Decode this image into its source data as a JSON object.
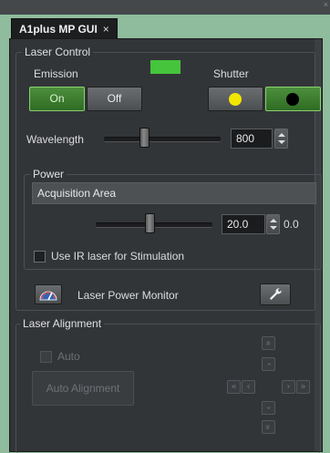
{
  "window": {
    "tab_title": "A1plus MP GUI",
    "tab_close": "×",
    "corner_close": "×"
  },
  "laser_control": {
    "title": "Laser Control",
    "emission_label": "Emission",
    "on_label": "On",
    "off_label": "Off",
    "emission_state": "on",
    "indicator_color": "#45c53c",
    "shutter_label": "Shutter",
    "shutter_open_color": "#f2e600",
    "shutter_closed_color": "#000000",
    "wavelength_label": "Wavelength",
    "wavelength_value": "800"
  },
  "power": {
    "title": "Power",
    "mode": "Acquisition Area",
    "value": "20.0",
    "readout": "0.0",
    "ir_stimulation_label": "Use IR laser for Stimulation",
    "ir_stimulation_checked": false
  },
  "monitor": {
    "label": "Laser Power Monitor",
    "gauge_icon": "gauge-icon",
    "settings_icon": "wrench-icon"
  },
  "alignment": {
    "title": "Laser Alignment",
    "auto_label": "Auto",
    "auto_checked": false,
    "auto_alignment_label": "Auto Alignment",
    "arrows": {
      "up_fast": "«",
      "up": "‹",
      "down": "‹",
      "down_fast": "«",
      "left_fast": "«",
      "left": "‹",
      "right": "›",
      "right_fast": "»"
    }
  }
}
